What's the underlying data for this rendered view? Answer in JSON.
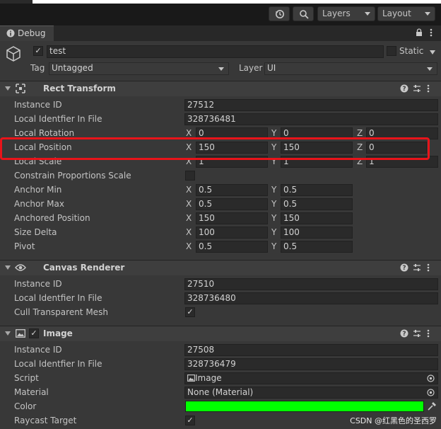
{
  "toolbar": {
    "layers_label": "Layers",
    "layout_label": "Layout"
  },
  "tab": {
    "label": "Debug"
  },
  "object": {
    "name": "test",
    "active": true,
    "static_label": "Static",
    "tag_label": "Tag",
    "tag_value": "Untagged",
    "layer_label": "Layer",
    "layer_value": "UI"
  },
  "rect_transform": {
    "title": "Rect Transform",
    "instance_id_label": "Instance ID",
    "instance_id": "27512",
    "local_id_label": "Local Identfier In File",
    "local_id": "328736481",
    "local_rotation_label": "Local Rotation",
    "local_rotation": {
      "x": "0",
      "y": "0",
      "z": "0"
    },
    "local_position_label": "Local Position",
    "local_position": {
      "x": "150",
      "y": "150",
      "z": "0"
    },
    "local_scale_label": "Local Scale",
    "local_scale": {
      "x": "1",
      "y": "1",
      "z": "1"
    },
    "constrain_label": "Constrain Proportions Scale",
    "anchor_min_label": "Anchor Min",
    "anchor_min": {
      "x": "0.5",
      "y": "0.5"
    },
    "anchor_max_label": "Anchor Max",
    "anchor_max": {
      "x": "0.5",
      "y": "0.5"
    },
    "anchored_position_label": "Anchored Position",
    "anchored_position": {
      "x": "150",
      "y": "150"
    },
    "size_delta_label": "Size Delta",
    "size_delta": {
      "x": "100",
      "y": "100"
    },
    "pivot_label": "Pivot",
    "pivot": {
      "x": "0.5",
      "y": "0.5"
    }
  },
  "axes": {
    "x": "X",
    "y": "Y",
    "z": "Z"
  },
  "canvas_renderer": {
    "title": "Canvas Renderer",
    "instance_id_label": "Instance ID",
    "instance_id": "27510",
    "local_id_label": "Local Identfier In File",
    "local_id": "328736480",
    "cull_label": "Cull Transparent Mesh",
    "cull": true
  },
  "image": {
    "title": "Image",
    "enabled": true,
    "instance_id_label": "Instance ID",
    "instance_id": "27508",
    "local_id_label": "Local Identfier In File",
    "local_id": "328736479",
    "script_label": "Script",
    "script_value": "Image",
    "material_label": "Material",
    "material_value": "None (Material)",
    "color_label": "Color",
    "color_value": "#00ff00",
    "raycast_label": "Raycast Target",
    "raycast": true
  },
  "watermark": "CSDN @红黑色的圣西罗"
}
